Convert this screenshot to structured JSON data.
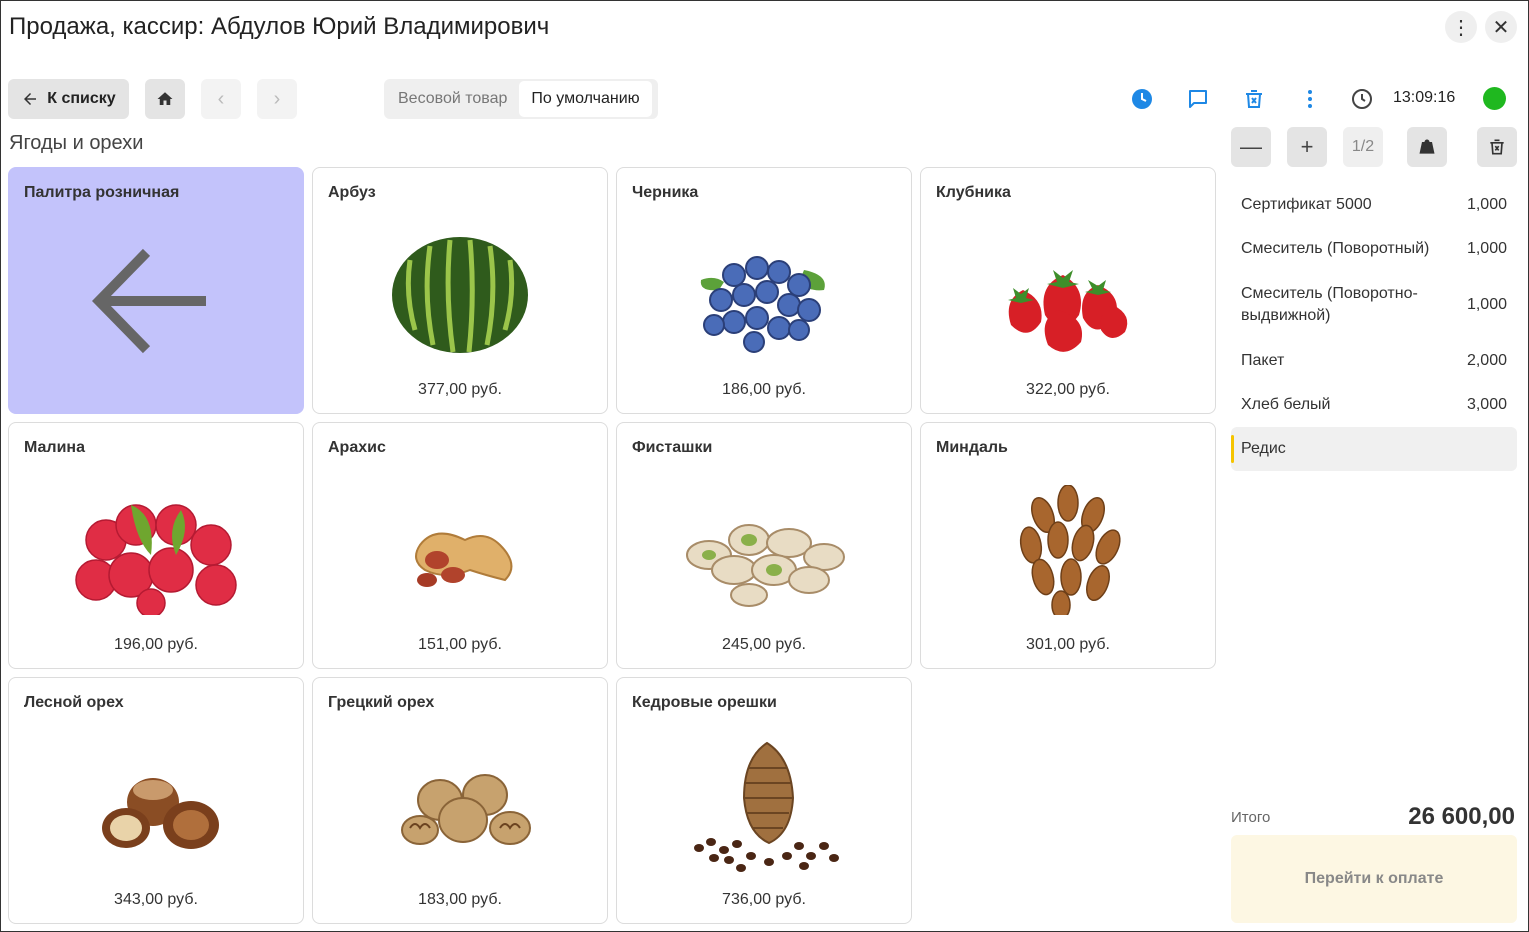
{
  "window": {
    "title": "Продажа, кассир: Абдулов Юрий Владимирович",
    "menu_icon": "more-vert-icon",
    "close_icon": "close-icon"
  },
  "toolbar": {
    "back_label": "К списку",
    "tabs": [
      {
        "label": "Весовой товар",
        "active": false
      },
      {
        "label": "По умолчанию",
        "active": true
      }
    ],
    "time": "13:09:16",
    "status_color": "#1fb81f"
  },
  "section": {
    "title": "Ягоды и орехи"
  },
  "products": [
    {
      "name": "Палитра розничная",
      "price": "",
      "kind": "palette"
    },
    {
      "name": "Арбуз",
      "price": "377,00 руб.",
      "kind": "watermelon"
    },
    {
      "name": "Черника",
      "price": "186,00 руб.",
      "kind": "blueberry"
    },
    {
      "name": "Клубника",
      "price": "322,00 руб.",
      "kind": "strawberry"
    },
    {
      "name": "Малина",
      "price": "196,00 руб.",
      "kind": "raspberry"
    },
    {
      "name": "Арахис",
      "price": "151,00 руб.",
      "kind": "peanut"
    },
    {
      "name": "Фисташки",
      "price": "245,00 руб.",
      "kind": "pistachio"
    },
    {
      "name": "Миндаль",
      "price": "301,00 руб.",
      "kind": "almond"
    },
    {
      "name": "Лесной орех",
      "price": "343,00 руб.",
      "kind": "hazelnut"
    },
    {
      "name": "Грецкий орех",
      "price": "183,00 руб.",
      "kind": "walnut"
    },
    {
      "name": "Кедровые орешки",
      "price": "736,00 руб.",
      "kind": "pinenut"
    }
  ],
  "receipt": {
    "page": "1/2",
    "items": [
      {
        "name": "Сертификат 5000",
        "qty": "1,000",
        "selected": false
      },
      {
        "name": "Смеситель (Поворотный)",
        "qty": "1,000",
        "selected": false
      },
      {
        "name": "Смеситель (Поворотно-выдвижной)",
        "qty": "1,000",
        "selected": false
      },
      {
        "name": "Пакет",
        "qty": "2,000",
        "selected": false
      },
      {
        "name": "Хлеб белый",
        "qty": "3,000",
        "selected": false
      },
      {
        "name": "Редис",
        "qty": "",
        "selected": true
      }
    ],
    "total_label": "Итого",
    "total_value": "26 600,00",
    "pay_label": "Перейти к оплате"
  },
  "colors": {
    "palette_tile": "#c3c3fb",
    "accent_blue": "#1e88e5",
    "selection_marker": "#f5c400",
    "pay_button_bg": "#fdf7e3"
  }
}
